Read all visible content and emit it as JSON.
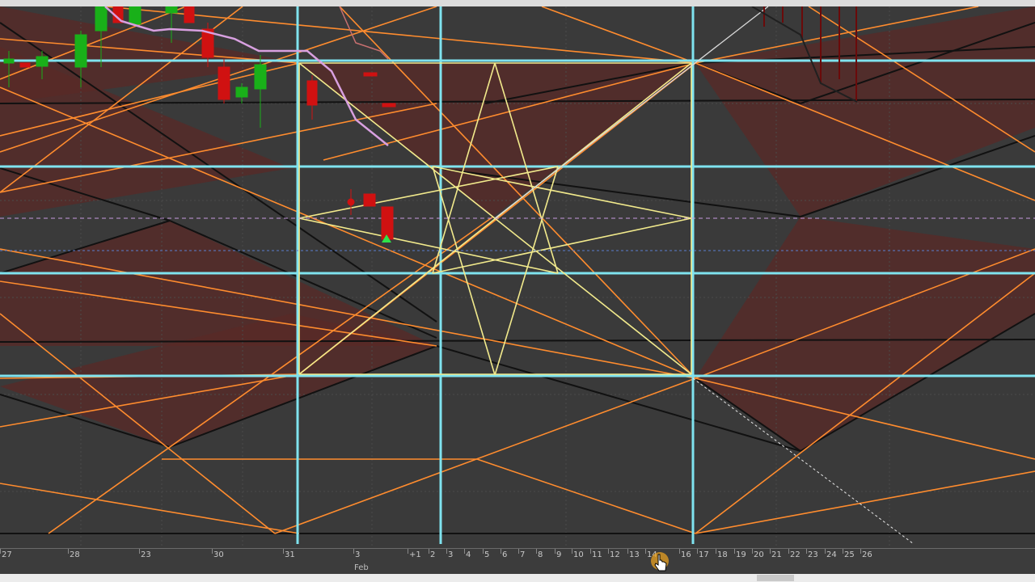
{
  "time_axis": {
    "ticks": [
      "27",
      "28",
      "23",
      "30",
      "31",
      "3",
      "+1",
      "2",
      "3",
      "4",
      "5",
      "6",
      "7",
      "8",
      "9",
      "10",
      "11",
      "12",
      "13",
      "14",
      "16",
      "17",
      "18",
      "19",
      "20",
      "21",
      "22",
      "23",
      "24",
      "25",
      "26"
    ],
    "month_label": "Feb"
  },
  "colors": {
    "background": "#3a3a3a",
    "time_cycle_lines": "#7fe3ef",
    "fan_lines": "#ff8c2e",
    "star_lines": "#f2ea8c",
    "shade_fill": "#5a2a27",
    "dark_lines": "#111111",
    "bull_candle": "#19b019",
    "bear_candle": "#d01111",
    "ma_line": "#d8a0e0"
  },
  "icons": [
    "hand-cursor-icon"
  ]
}
